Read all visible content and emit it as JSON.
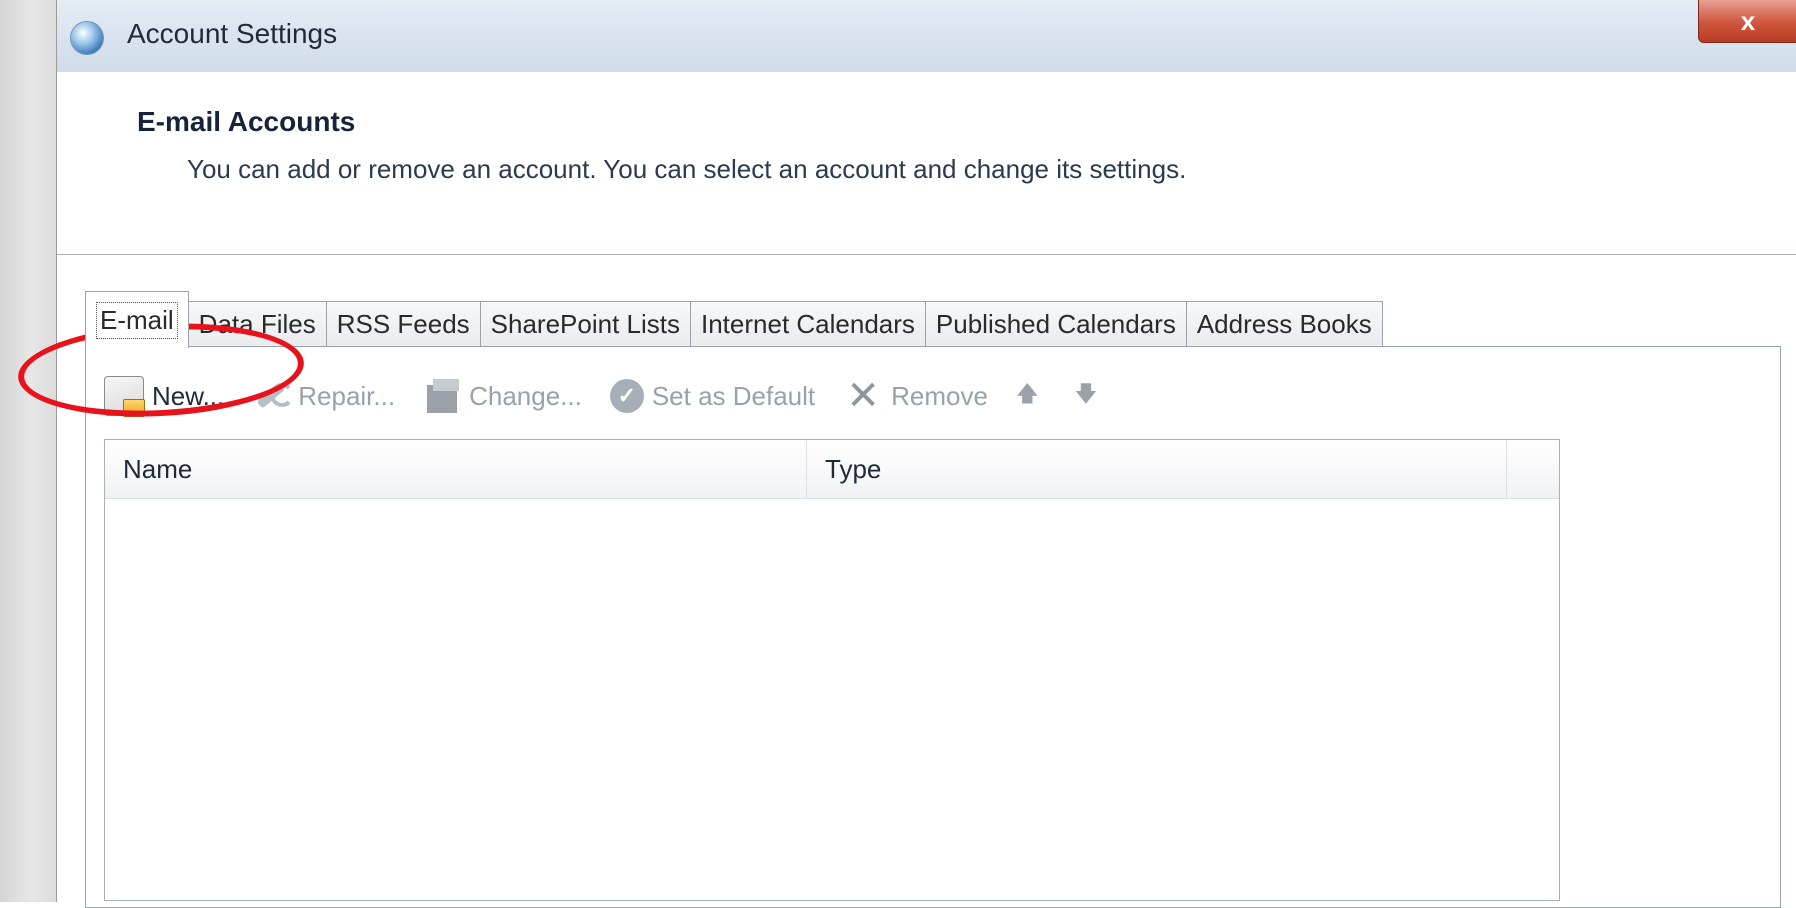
{
  "window": {
    "title": "Account Settings",
    "close_label": "x"
  },
  "header": {
    "title": "E-mail Accounts",
    "description": "You can add or remove an account. You can select an account and change its settings."
  },
  "tabs": [
    {
      "label": "E-mail",
      "active": true
    },
    {
      "label": "Data Files",
      "active": false
    },
    {
      "label": "RSS Feeds",
      "active": false
    },
    {
      "label": "SharePoint Lists",
      "active": false
    },
    {
      "label": "Internet Calendars",
      "active": false
    },
    {
      "label": "Published Calendars",
      "active": false
    },
    {
      "label": "Address Books",
      "active": false
    }
  ],
  "toolbar": {
    "new": {
      "label": "New...",
      "icon": "new-account-icon",
      "enabled": true
    },
    "repair": {
      "label": "Repair...",
      "icon": "wrench-icon",
      "enabled": false
    },
    "change": {
      "label": "Change...",
      "icon": "change-icon",
      "enabled": false
    },
    "set_default": {
      "label": "Set as Default",
      "icon": "checkmark-icon",
      "enabled": false
    },
    "remove": {
      "label": "Remove",
      "icon": "x-icon",
      "enabled": false
    },
    "move_up": {
      "icon": "arrow-up-icon",
      "glyph": "🡅"
    },
    "move_down": {
      "icon": "arrow-down-icon",
      "glyph": "🡇"
    }
  },
  "account_list": {
    "columns": [
      "Name",
      "Type"
    ],
    "rows": []
  },
  "annotation": {
    "color": "#e8121b",
    "target": "new-account-button"
  }
}
